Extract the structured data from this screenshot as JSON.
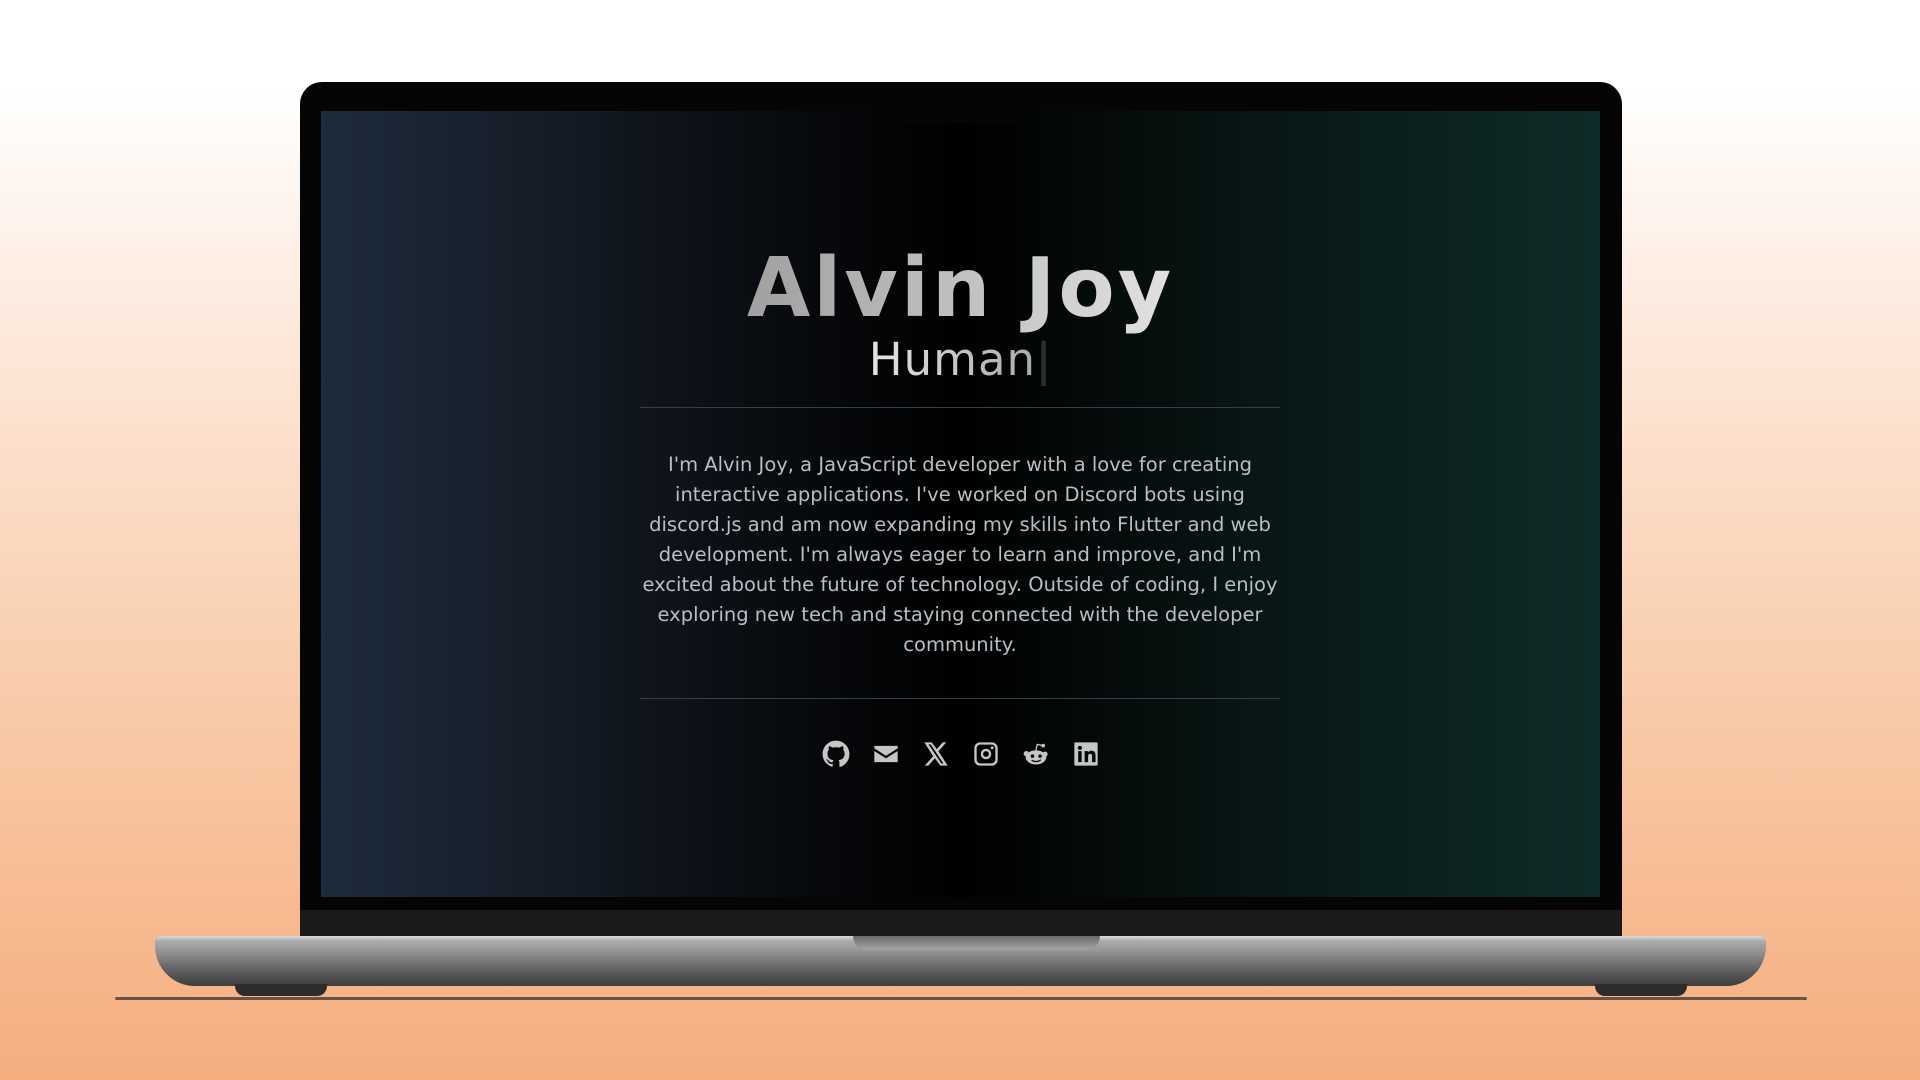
{
  "profile": {
    "name": "Alvin Joy",
    "role_typed": "Human",
    "cursor": "|",
    "bio": "I'm Alvin Joy, a JavaScript developer with a love for creating interactive applications. I've worked on Discord bots using discord.js and am now expanding my skills into Flutter and web development. I'm always eager to learn and improve, and I'm excited about the future of technology. Outside of coding, I enjoy exploring new tech and staying connected with the developer community."
  },
  "socials": [
    {
      "icon": "github-icon"
    },
    {
      "icon": "email-icon"
    },
    {
      "icon": "x-twitter-icon"
    },
    {
      "icon": "instagram-icon"
    },
    {
      "icon": "reddit-icon"
    },
    {
      "icon": "linkedin-icon"
    }
  ],
  "colors": {
    "page_gradient_top": "#ffffff",
    "page_gradient_bottom": "#f5ad7e",
    "screen_left": "#1d2b3c",
    "screen_center": "#000000",
    "screen_right": "#0e2b28",
    "bio_text": "#b9bec5",
    "icon": "#c6c6c6"
  }
}
